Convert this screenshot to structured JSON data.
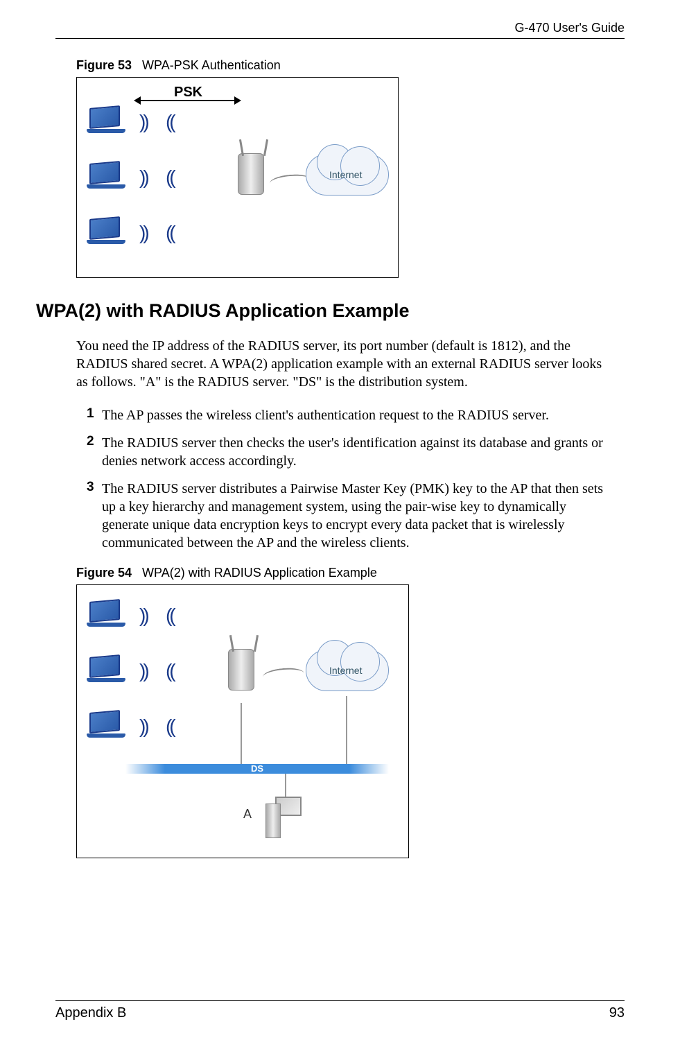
{
  "header": {
    "guide_title": "G-470 User's Guide"
  },
  "figure53": {
    "label_prefix": "Figure 53",
    "caption": "WPA-PSK Authentication",
    "psk_label": "PSK",
    "internet_label": "Internet"
  },
  "section": {
    "heading": "WPA(2) with RADIUS Application Example",
    "intro": "You need the IP address of the RADIUS server, its port number (default is 1812), and the RADIUS shared secret. A WPA(2) application example with an external RADIUS server looks as follows. \"A\" is the RADIUS server. \"DS\" is the distribution system.",
    "steps": [
      {
        "num": "1",
        "text": "The AP passes the wireless client's authentication request to the RADIUS server."
      },
      {
        "num": "2",
        "text": "The RADIUS server then checks the user's identification against its database and grants or denies network access accordingly."
      },
      {
        "num": "3",
        "text": "The RADIUS server distributes a Pairwise Master Key (PMK) key to the AP that then sets up a key hierarchy and management system, using the pair-wise key to dynamically generate unique data encryption keys to encrypt every data packet that is wirelessly communicated between the AP and the wireless clients."
      }
    ]
  },
  "figure54": {
    "label_prefix": "Figure 54",
    "caption": "WPA(2) with RADIUS Application Example",
    "internet_label": "Internet",
    "ds_label": "DS",
    "a_label": "A"
  },
  "footer": {
    "section": "Appendix B",
    "page": "93"
  }
}
